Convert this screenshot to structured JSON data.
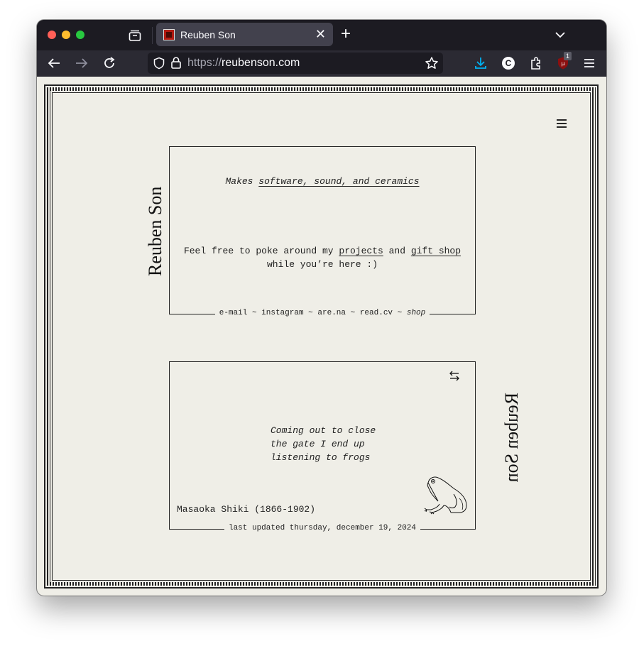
{
  "browser": {
    "tab_title": "Reuben Son",
    "url_scheme": "https://",
    "url_host": "reubenson.com",
    "extension_badge": "1",
    "account_initial": "C"
  },
  "page": {
    "name": "Reuben Son",
    "tagline_prefix": "Makes ",
    "tagline_link": "software, sound, and ceramics",
    "intro_1": "Feel free to poke around my ",
    "intro_projects": "projects",
    "intro_and": " and ",
    "intro_gift_shop": "gift shop",
    "intro_2": "while you’re here :)",
    "links": [
      "e-mail",
      "instagram",
      "are.na",
      "read.cv",
      "shop"
    ],
    "sep": " ~ ",
    "poem_lines": [
      "Coming out to close",
      "the gate I end up",
      "listening to frogs"
    ],
    "poem_author": "Masaoka Shiki (1866-1902)",
    "last_updated": "last updated thursday, december 19, 2024"
  },
  "colors": {
    "page_bg": "#efeee7",
    "ink": "#222222",
    "chrome_dark": "#1c1b22",
    "chrome_nav": "#2b2a33",
    "download_accent": "#00b3f4"
  }
}
